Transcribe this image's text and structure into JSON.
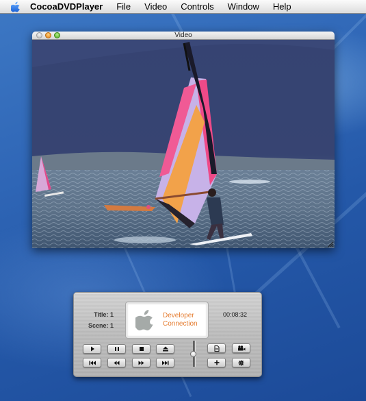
{
  "menubar": {
    "app_name": "CocoaDVDPlayer",
    "items": [
      "File",
      "Video",
      "Controls",
      "Window",
      "Help"
    ]
  },
  "video_window": {
    "title": "Video",
    "traffic_lights": [
      "close",
      "minimize",
      "zoom"
    ],
    "content_description": "Windsurfer with pink, lavender and orange sail on choppy blue-grey water, dark hills in background"
  },
  "controller": {
    "title_label": "Title: 1",
    "scene_label": "Scene: 1",
    "elapsed_time": "00:08:32",
    "display": {
      "logo": "apple-logo",
      "line1": "Developer",
      "line2": "Connection",
      "text_color": "#e57b2e"
    },
    "transport_buttons": [
      {
        "name": "play",
        "icon": "play-icon"
      },
      {
        "name": "pause",
        "icon": "pause-icon"
      },
      {
        "name": "stop",
        "icon": "stop-icon"
      },
      {
        "name": "eject",
        "icon": "eject-icon"
      },
      {
        "name": "previous-chapter",
        "icon": "skip-back-icon"
      },
      {
        "name": "rewind",
        "icon": "rewind-icon"
      },
      {
        "name": "fast-forward",
        "icon": "fast-forward-icon"
      },
      {
        "name": "next-chapter",
        "icon": "skip-forward-icon"
      }
    ],
    "volume_level": 0.5,
    "extra_buttons": [
      {
        "name": "menu",
        "icon": "document-icon"
      },
      {
        "name": "camera-angle",
        "icon": "video-camera-icon"
      },
      {
        "name": "add",
        "icon": "plus-icon",
        "label": "+"
      },
      {
        "name": "settings",
        "icon": "gear-icon"
      }
    ]
  }
}
